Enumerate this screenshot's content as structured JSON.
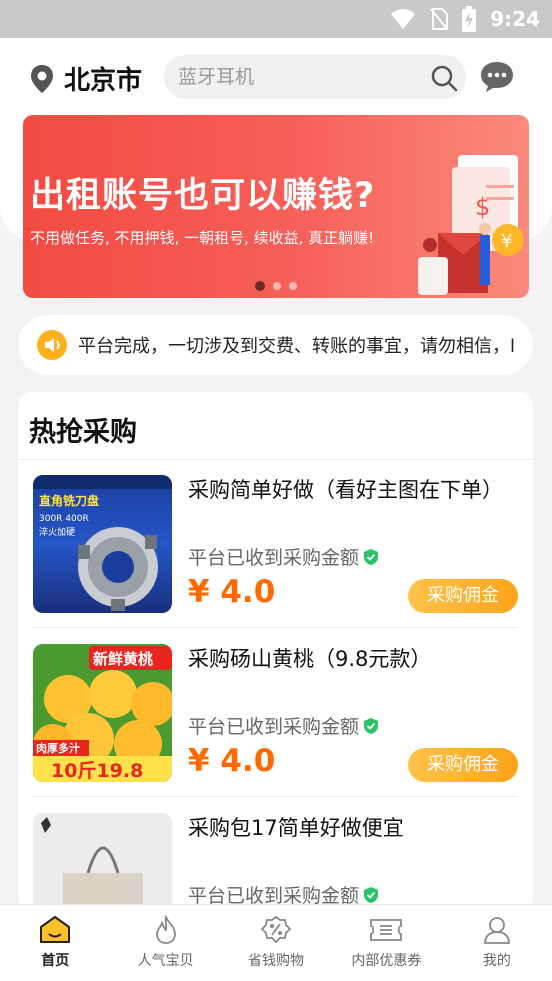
{
  "status": {
    "time": "9:24"
  },
  "header": {
    "city": "北京市",
    "search_placeholder": "蓝牙耳机"
  },
  "banner": {
    "title": "出租账号也可以赚钱?",
    "subtitle": "不用做任务, 不用押钱, 一朝租号, 续收益, 真正躺赚!",
    "coin_symbol": "¥",
    "dollar_symbol": "$"
  },
  "notice": {
    "text": "平台完成，一切涉及到交费、转账的事宜，请勿相信，l"
  },
  "hot": {
    "title": "热抢采购",
    "items": [
      {
        "name": "采购简单好做（看好主图在下单）",
        "note": "平台已收到采购金额",
        "price": "¥ 4.0",
        "button": "采购佣金",
        "thumb_text_1": "直角铣刀盘",
        "thumb_text_2": "300R 400R",
        "thumb_text_3": "淬火加硬"
      },
      {
        "name": "采购砀山黄桃（9.8元款）",
        "note": "平台已收到采购金额",
        "price": "¥ 4.0",
        "button": "采购佣金",
        "thumb_text_1": "新鲜黄桃",
        "thumb_text_2": "肉厚多汁",
        "thumb_text_3": "10斤19.8"
      },
      {
        "name": "采购包17简单好做便宜",
        "note": "平台已收到采购金额",
        "price": "",
        "button": ""
      }
    ]
  },
  "tabs": [
    {
      "label": "首页",
      "icon": "home-icon",
      "active": true
    },
    {
      "label": "人气宝贝",
      "icon": "fire-icon",
      "active": false
    },
    {
      "label": "省钱购物",
      "icon": "discount-icon",
      "active": false
    },
    {
      "label": "内部优惠券",
      "icon": "coupon-icon",
      "active": false
    },
    {
      "label": "我的",
      "icon": "user-icon",
      "active": false
    }
  ],
  "colors": {
    "accent": "#ffa31a",
    "price": "#ff6a00",
    "banner": "#f24a42",
    "verified": "#2bc36a"
  }
}
